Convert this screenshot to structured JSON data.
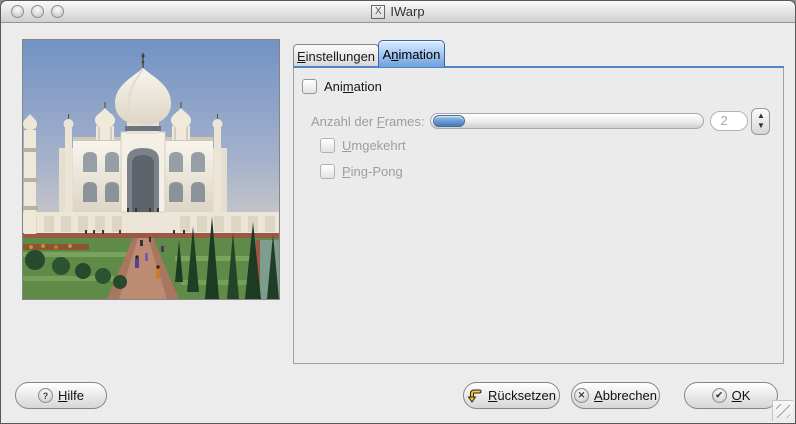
{
  "window": {
    "title": "IWarp",
    "icon_glyph": "X"
  },
  "titlebar": {
    "buttons": [
      "close",
      "minimize",
      "zoom"
    ]
  },
  "tabs": [
    {
      "id": "einstellungen",
      "pre": "",
      "key": "E",
      "post": "instellungen",
      "active": false
    },
    {
      "id": "animation",
      "pre": "A",
      "key": "n",
      "post": "imation",
      "active": true
    }
  ],
  "panel": {
    "animation_checkbox": {
      "pre": "Ani",
      "key": "m",
      "post": "ation",
      "checked": false,
      "enabled": true
    },
    "frames": {
      "pre": "Anzahl der ",
      "key": "F",
      "post": "rames:",
      "value": "2",
      "slider_at_minimum": true,
      "enabled": false
    },
    "umgekehrt": {
      "pre": "",
      "key": "U",
      "post": "mgekehrt",
      "checked": false,
      "enabled": false
    },
    "pingpong": {
      "pre": "",
      "key": "P",
      "post": "ing-Pong",
      "checked": false,
      "enabled": false
    }
  },
  "spinner": {
    "up": "▲",
    "down": "▼"
  },
  "buttons": {
    "help": {
      "pre": "",
      "key": "H",
      "post": "ilfe",
      "icon": "help-icon",
      "glyph": "?"
    },
    "reset": {
      "pre": "",
      "key": "R",
      "post": "ücksetzen",
      "icon": "revert-icon"
    },
    "cancel": {
      "pre": "",
      "key": "A",
      "post": "bbrechen",
      "icon": "cancel-icon",
      "glyph": "✕"
    },
    "ok": {
      "pre": "",
      "key": "O",
      "post": "K",
      "icon": "ok-icon",
      "glyph": "✔"
    }
  },
  "colors": {
    "accent_blue": "#4e86c8",
    "tab_active_fill": "#a9caf2",
    "slider_handle_blue": "#6fa0d8",
    "disabled_text": "#9d9d9d",
    "window_bg": "#ececec"
  },
  "preview": {
    "subject": "taj-mahal-photo"
  }
}
